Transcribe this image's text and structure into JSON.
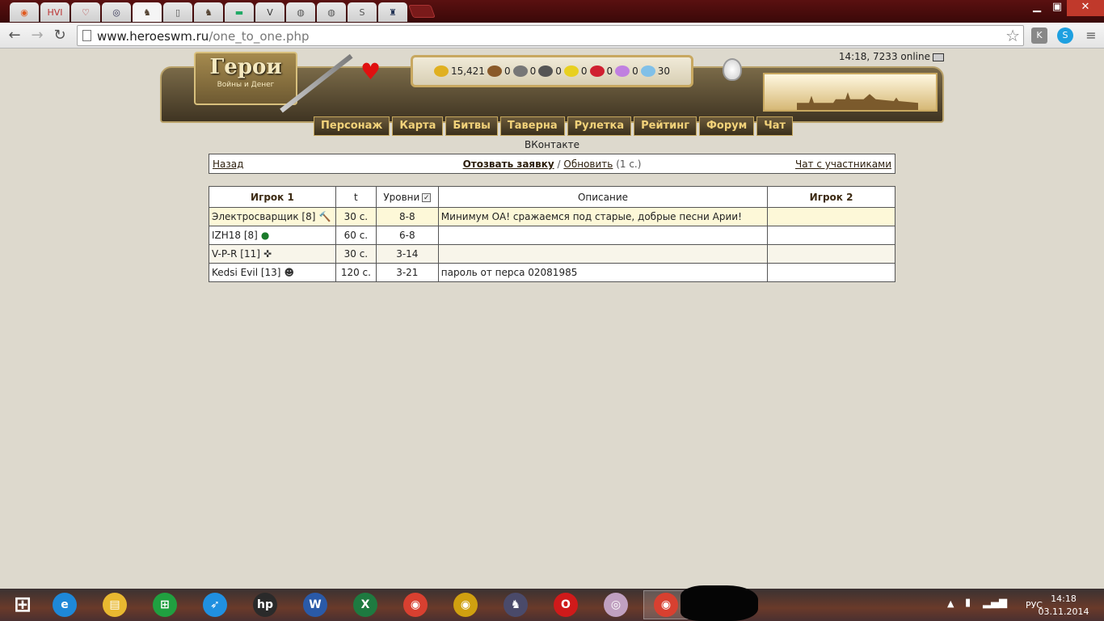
{
  "browser": {
    "tabs": [
      {
        "glyph": "◉",
        "color": "#e05a20"
      },
      {
        "glyph": "HVI",
        "color": "#b33"
      },
      {
        "glyph": "♡",
        "color": "#a22"
      },
      {
        "glyph": "◎",
        "color": "#335"
      },
      {
        "glyph": "♞",
        "color": "#543"
      },
      {
        "glyph": "▯",
        "color": "#555"
      },
      {
        "glyph": "♞",
        "color": "#543"
      },
      {
        "glyph": "▬",
        "color": "#2a6"
      },
      {
        "glyph": "V",
        "color": "#333"
      },
      {
        "glyph": "◍",
        "color": "#555"
      },
      {
        "glyph": "◍",
        "color": "#555"
      },
      {
        "glyph": "S",
        "color": "#555"
      },
      {
        "glyph": "♜",
        "color": "#235"
      }
    ],
    "url_host": "www.heroeswm.ru",
    "url_path": "/one_to_one.php"
  },
  "header": {
    "logo_title": "Герои",
    "logo_subtitle": "Войны и Денег",
    "resources": [
      {
        "name": "gold",
        "value": "15,421",
        "color": "#e0b020"
      },
      {
        "name": "wood",
        "value": "0",
        "color": "#8a5a2a"
      },
      {
        "name": "ore",
        "value": "0",
        "color": "#777"
      },
      {
        "name": "mercury",
        "value": "0",
        "color": "#555"
      },
      {
        "name": "sulfur",
        "value": "0",
        "color": "#e8d020"
      },
      {
        "name": "crystals",
        "value": "0",
        "color": "#d02030"
      },
      {
        "name": "gems",
        "value": "0",
        "color": "#c080e0"
      },
      {
        "name": "diamonds",
        "value": "30",
        "color": "#80c0e8"
      }
    ],
    "online_text": "14:18, 7233 online",
    "menu": [
      "Персонаж",
      "Карта",
      "Битвы",
      "Таверна",
      "Рулетка",
      "Рейтинг",
      "Форум",
      "Чат"
    ],
    "vk_label": "ВКонтакте"
  },
  "nav": {
    "back": "Назад",
    "withdraw": "Отозвать заявку",
    "separator": "/",
    "refresh": "Обновить",
    "refresh_note": "(1 с.)",
    "chat": "Чат с участниками"
  },
  "table": {
    "headers": {
      "player1": "Игрок 1",
      "time": "t",
      "levels": "Уровни",
      "description": "Описание",
      "player2": "Игрок 2"
    },
    "rows": [
      {
        "player1": "Электросварщик [8]",
        "icon": "hammer",
        "time": "30 с.",
        "levels": "8-8",
        "description": "Минимум ОА! сражаемся под старые, добрые песни Арии!",
        "player2": ""
      },
      {
        "player1": "IZH18 [8]",
        "icon": "leaf",
        "time": "60 с.",
        "levels": "6-8",
        "description": "",
        "player2": ""
      },
      {
        "player1": "V-P-R [11]",
        "icon": "cross",
        "time": "30 с.",
        "levels": "3-14",
        "description": "",
        "player2": ""
      },
      {
        "player1": "Kedsi Evil [13]",
        "icon": "skull",
        "time": "120 с.",
        "levels": "3-21",
        "description": "пароль от перса 02081985",
        "player2": ""
      }
    ]
  },
  "taskbar": {
    "lang": "РУС",
    "time": "14:18",
    "date": "03.11.2014",
    "apps": [
      {
        "name": "internet-explorer",
        "glyph": "e",
        "color": "#1e88d8"
      },
      {
        "name": "file-explorer",
        "glyph": "▤",
        "color": "#e8b830"
      },
      {
        "name": "store",
        "glyph": "⊞",
        "color": "#20a040"
      },
      {
        "name": "rocket",
        "glyph": "➶",
        "color": "#2090e0"
      },
      {
        "name": "hp",
        "glyph": "hp",
        "color": "#2a2a2a"
      },
      {
        "name": "word",
        "glyph": "W",
        "color": "#2a5aa8"
      },
      {
        "name": "excel",
        "glyph": "X",
        "color": "#1e7a40"
      },
      {
        "name": "chrome",
        "glyph": "◉",
        "color": "#d84030"
      },
      {
        "name": "media",
        "glyph": "◉",
        "color": "#d0a010"
      },
      {
        "name": "heroes-game",
        "glyph": "♞",
        "color": "#4a4a6a"
      },
      {
        "name": "opera",
        "glyph": "O",
        "color": "#d01a1a"
      },
      {
        "name": "disc",
        "glyph": "◎",
        "color": "#c0a0c0"
      },
      {
        "name": "chrome-active",
        "glyph": "◉",
        "color": "#d84030"
      }
    ]
  }
}
